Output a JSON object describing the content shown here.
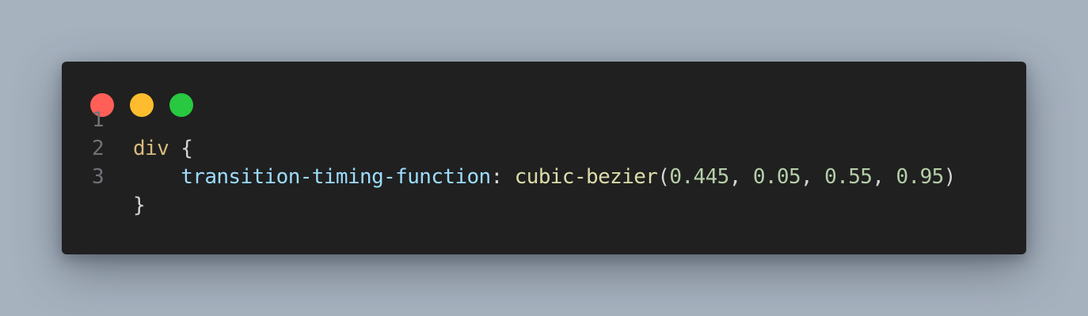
{
  "window": {
    "controls": [
      "close",
      "minimize",
      "maximize"
    ],
    "colors": {
      "close": "#ff5f57",
      "minimize": "#febc2e",
      "maximize": "#28c840",
      "background": "#202020"
    }
  },
  "code": {
    "lines": [
      {
        "number": "1",
        "selector": "div",
        "open_brace": " {"
      },
      {
        "number": "2",
        "indent": "    ",
        "property": "transition-timing-function",
        "colon": ": ",
        "function": "cubic-bezier",
        "paren_open": "(",
        "arg1": "0.445",
        "sep1": ", ",
        "arg2": "0.05",
        "sep2": ", ",
        "arg3": "0.55",
        "sep3": ", ",
        "arg4": "0.95",
        "paren_close": ")"
      },
      {
        "number": "3",
        "close_brace": "}"
      }
    ]
  }
}
